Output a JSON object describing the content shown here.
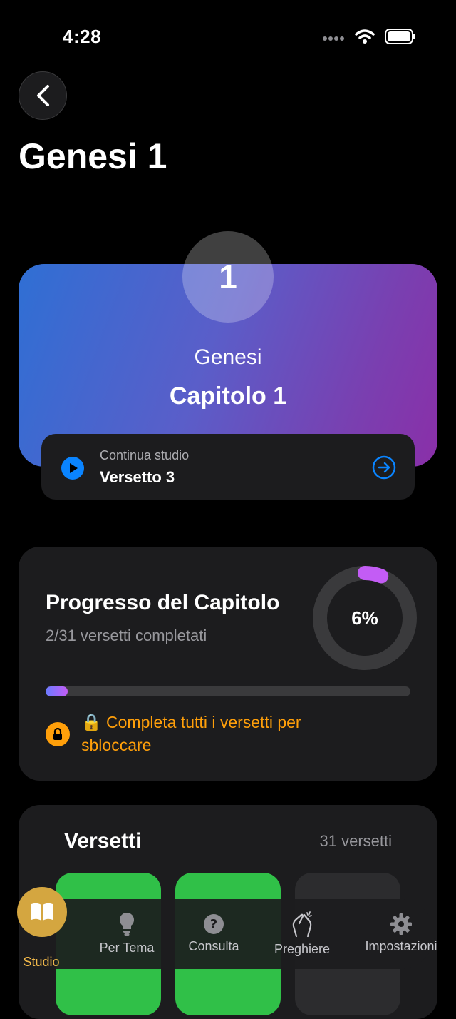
{
  "status_bar": {
    "time": "4:28"
  },
  "header": {
    "title": "Genesi 1"
  },
  "hero": {
    "chapter_number": "1",
    "book": "Genesi",
    "chapter_label": "Capitolo 1"
  },
  "continue_study": {
    "label": "Continua studio",
    "verse": "Versetto 3"
  },
  "progress": {
    "title": "Progresso del Capitolo",
    "subtitle": "2/31 versetti completati",
    "percent_label": "6%",
    "percent": 6,
    "unlock_message": "🔒 Completa tutti i versetti per sbloccare"
  },
  "verses": {
    "title": "Versetti",
    "count": "31 versetti"
  },
  "tabs": [
    {
      "label": "Studio",
      "icon": "book-icon",
      "active": true
    },
    {
      "label": "Per Tema",
      "icon": "lightbulb-icon"
    },
    {
      "label": "Consulta",
      "icon": "question-icon"
    },
    {
      "label": "Preghiere",
      "icon": "praying-hands-icon"
    },
    {
      "label": "Impostazioni",
      "icon": "gear-icon"
    }
  ],
  "colors": {
    "accent_blue": "#0a84ff",
    "accent_orange": "#ff9f0a",
    "progress_purple": "#c35cf5",
    "tab_active": "#d4a640",
    "verse_done": "#30c048"
  }
}
